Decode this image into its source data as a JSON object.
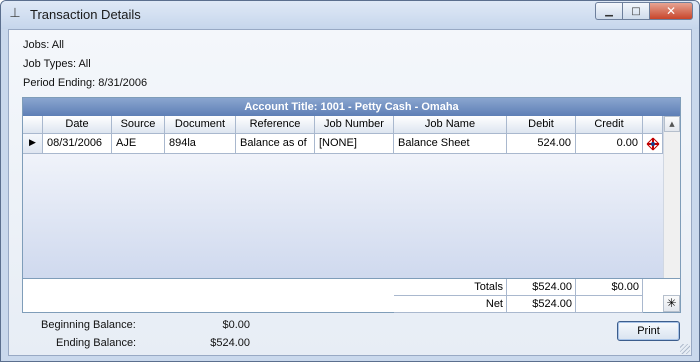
{
  "window": {
    "title": "Transaction Details",
    "icon": "pin-icon"
  },
  "info": {
    "jobs": "Jobs: All",
    "job_types": "Job Types: All",
    "period_ending": "Period Ending: 8/31/2006"
  },
  "grid": {
    "caption": "Account Title: 1001 - Petty Cash - Omaha",
    "columns": [
      "Date",
      "Source",
      "Document",
      "Reference",
      "Job Number",
      "Job Name",
      "Debit",
      "Credit"
    ],
    "rows": [
      {
        "date": "08/31/2006",
        "source": "AJE",
        "document": "894la",
        "reference": "Balance as of",
        "job_number": "[NONE]",
        "job_name": "Balance Sheet",
        "debit": "524.00",
        "credit": "0.00",
        "action_icon": "drill-down-icon"
      }
    ],
    "totals": {
      "totals_label": "Totals",
      "totals_debit": "$524.00",
      "totals_credit": "$0.00",
      "net_label": "Net",
      "net_debit": "$524.00"
    }
  },
  "balances": {
    "beginning_label": "Beginning Balance:",
    "beginning_value": "$0.00",
    "ending_label": "Ending Balance:",
    "ending_value": "$524.00"
  },
  "buttons": {
    "print": "Print"
  }
}
